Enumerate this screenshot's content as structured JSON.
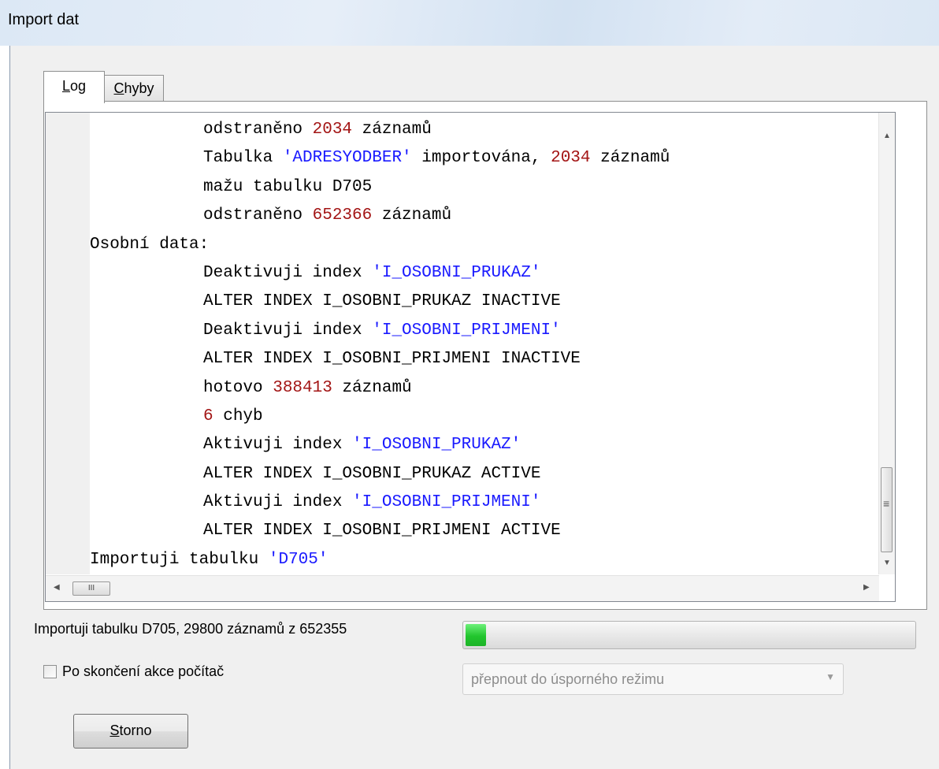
{
  "window": {
    "title": "Import dat"
  },
  "tabs": [
    {
      "label_mnemonic": "L",
      "label_rest": "og",
      "active": true
    },
    {
      "label_mnemonic": "C",
      "label_rest": "hyby",
      "active": false
    }
  ],
  "log": {
    "lines": [
      {
        "indent": 2,
        "parts": [
          {
            "t": "odstraněno ",
            "k": "txt"
          },
          {
            "t": "2034",
            "k": "num"
          },
          {
            "t": " záznamů",
            "k": "txt"
          }
        ]
      },
      {
        "indent": 2,
        "parts": [
          {
            "t": "Tabulka ",
            "k": "txt"
          },
          {
            "t": "'ADRESYODBER'",
            "k": "str"
          },
          {
            "t": " importována, ",
            "k": "txt"
          },
          {
            "t": "2034",
            "k": "num"
          },
          {
            "t": " záznamů",
            "k": "txt"
          }
        ]
      },
      {
        "indent": 2,
        "parts": [
          {
            "t": "mažu tabulku D705",
            "k": "txt"
          }
        ]
      },
      {
        "indent": 2,
        "parts": [
          {
            "t": "odstraněno ",
            "k": "txt"
          },
          {
            "t": "652366",
            "k": "num"
          },
          {
            "t": " záznamů",
            "k": "txt"
          }
        ]
      },
      {
        "indent": 0,
        "parts": [
          {
            "t": "Osobní data:",
            "k": "txt"
          }
        ]
      },
      {
        "indent": 2,
        "parts": [
          {
            "t": "Deaktivuji index ",
            "k": "txt"
          },
          {
            "t": "'I_OSOBNI_PRUKAZ'",
            "k": "str"
          }
        ]
      },
      {
        "indent": 2,
        "parts": [
          {
            "t": "ALTER INDEX I_OSOBNI_PRUKAZ INACTIVE",
            "k": "txt"
          }
        ]
      },
      {
        "indent": 2,
        "parts": [
          {
            "t": "Deaktivuji index ",
            "k": "txt"
          },
          {
            "t": "'I_OSOBNI_PRIJMENI'",
            "k": "str"
          }
        ]
      },
      {
        "indent": 2,
        "parts": [
          {
            "t": "ALTER INDEX I_OSOBNI_PRIJMENI INACTIVE",
            "k": "txt"
          }
        ]
      },
      {
        "indent": 2,
        "parts": [
          {
            "t": "hotovo ",
            "k": "txt"
          },
          {
            "t": "388413",
            "k": "num"
          },
          {
            "t": " záznamů",
            "k": "txt"
          }
        ]
      },
      {
        "indent": 2,
        "parts": [
          {
            "t": "6",
            "k": "num"
          },
          {
            "t": " chyb",
            "k": "txt"
          }
        ]
      },
      {
        "indent": 2,
        "parts": [
          {
            "t": "Aktivuji index ",
            "k": "txt"
          },
          {
            "t": "'I_OSOBNI_PRUKAZ'",
            "k": "str"
          }
        ]
      },
      {
        "indent": 2,
        "parts": [
          {
            "t": "ALTER INDEX I_OSOBNI_PRUKAZ ACTIVE",
            "k": "txt"
          }
        ]
      },
      {
        "indent": 2,
        "parts": [
          {
            "t": "Aktivuji index ",
            "k": "txt"
          },
          {
            "t": "'I_OSOBNI_PRIJMENI'",
            "k": "str"
          }
        ]
      },
      {
        "indent": 2,
        "parts": [
          {
            "t": "ALTER INDEX I_OSOBNI_PRIJMENI ACTIVE",
            "k": "txt"
          }
        ]
      },
      {
        "indent": 0,
        "parts": [
          {
            "t": "Importuji tabulku ",
            "k": "txt"
          },
          {
            "t": "'D705'",
            "k": "str"
          }
        ]
      }
    ],
    "colors": {
      "txt": "#000000",
      "num": "#a31515",
      "str": "#1a1aff"
    }
  },
  "status": {
    "text": "Importuji tabulku D705, 29800 záznamů z 652355",
    "progress_value": 29800,
    "progress_max": 652355,
    "progress_color": "#22c52e"
  },
  "shutdown": {
    "checkbox_label": "Po skončení akce počítač",
    "checked": false,
    "select_value": "přepnout do úsporného režimu"
  },
  "buttons": {
    "cancel_mnemonic": "S",
    "cancel_rest": "torno"
  },
  "icons": {
    "scroll_up": "▲",
    "scroll_down": "▼",
    "scroll_left": "◀",
    "scroll_right": "▶",
    "thumb_grip_h": "III",
    "thumb_grip_v": "≡",
    "dropdown": "▼"
  }
}
